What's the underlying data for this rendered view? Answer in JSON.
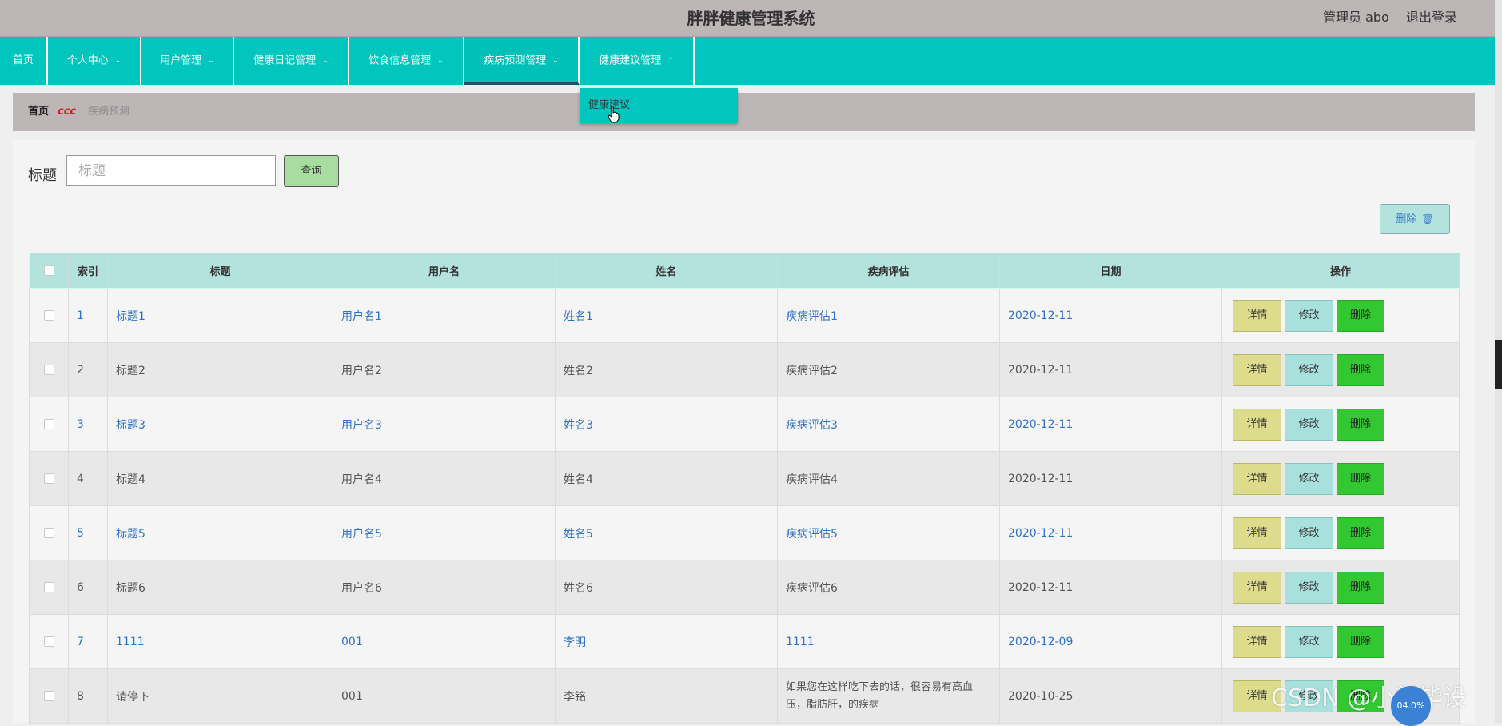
{
  "app": {
    "title": "胖胖健康管理系统",
    "admin_label": "管理员 abo",
    "logout_label": "退出登录"
  },
  "nav": {
    "items": [
      {
        "label": "首页",
        "has_dropdown": false
      },
      {
        "label": "个人中心",
        "has_dropdown": true
      },
      {
        "label": "用户管理",
        "has_dropdown": true
      },
      {
        "label": "健康日记管理",
        "has_dropdown": true
      },
      {
        "label": "饮食信息管理",
        "has_dropdown": true
      },
      {
        "label": "疾病预测管理",
        "has_dropdown": true,
        "active": true
      },
      {
        "label": "健康建议管理",
        "has_dropdown": true,
        "expanded": true
      }
    ],
    "dropdown_item": "健康建议"
  },
  "breadcrumb": {
    "home": "首页",
    "separator": "ccc",
    "current": "疾病预测"
  },
  "search": {
    "label": "标题",
    "placeholder": "标题",
    "value": "",
    "button_label": "查询"
  },
  "bulk_delete_label": "删除",
  "table": {
    "headers": [
      "索引",
      "标题",
      "用户名",
      "姓名",
      "疾病评估",
      "日期",
      "操作"
    ],
    "rows": [
      {
        "index": "1",
        "title": "标题1",
        "username": "用户名1",
        "name": "姓名1",
        "assessment": "疾病评估1",
        "date": "2020-12-11"
      },
      {
        "index": "2",
        "title": "标题2",
        "username": "用户名2",
        "name": "姓名2",
        "assessment": "疾病评估2",
        "date": "2020-12-11"
      },
      {
        "index": "3",
        "title": "标题3",
        "username": "用户名3",
        "name": "姓名3",
        "assessment": "疾病评估3",
        "date": "2020-12-11"
      },
      {
        "index": "4",
        "title": "标题4",
        "username": "用户名4",
        "name": "姓名4",
        "assessment": "疾病评估4",
        "date": "2020-12-11"
      },
      {
        "index": "5",
        "title": "标题5",
        "username": "用户名5",
        "name": "姓名5",
        "assessment": "疾病评估5",
        "date": "2020-12-11"
      },
      {
        "index": "6",
        "title": "标题6",
        "username": "用户名6",
        "name": "姓名6",
        "assessment": "疾病评估6",
        "date": "2020-12-11"
      },
      {
        "index": "7",
        "title": "1111",
        "username": "001",
        "name": "李明",
        "assessment": "1111",
        "date": "2020-12-09"
      },
      {
        "index": "8",
        "title": "请停下",
        "username": "001",
        "name": "李铭",
        "assessment": "如果您在这样吃下去的话，很容易有高血压，脂肪肝，的疾病",
        "date": "2020-10-25"
      }
    ],
    "actions": {
      "detail": "详情",
      "edit": "修改",
      "remove": "删除"
    }
  },
  "overlay": {
    "watermark": "CSDN @小新毕设",
    "float_badge": "04.0%"
  }
}
